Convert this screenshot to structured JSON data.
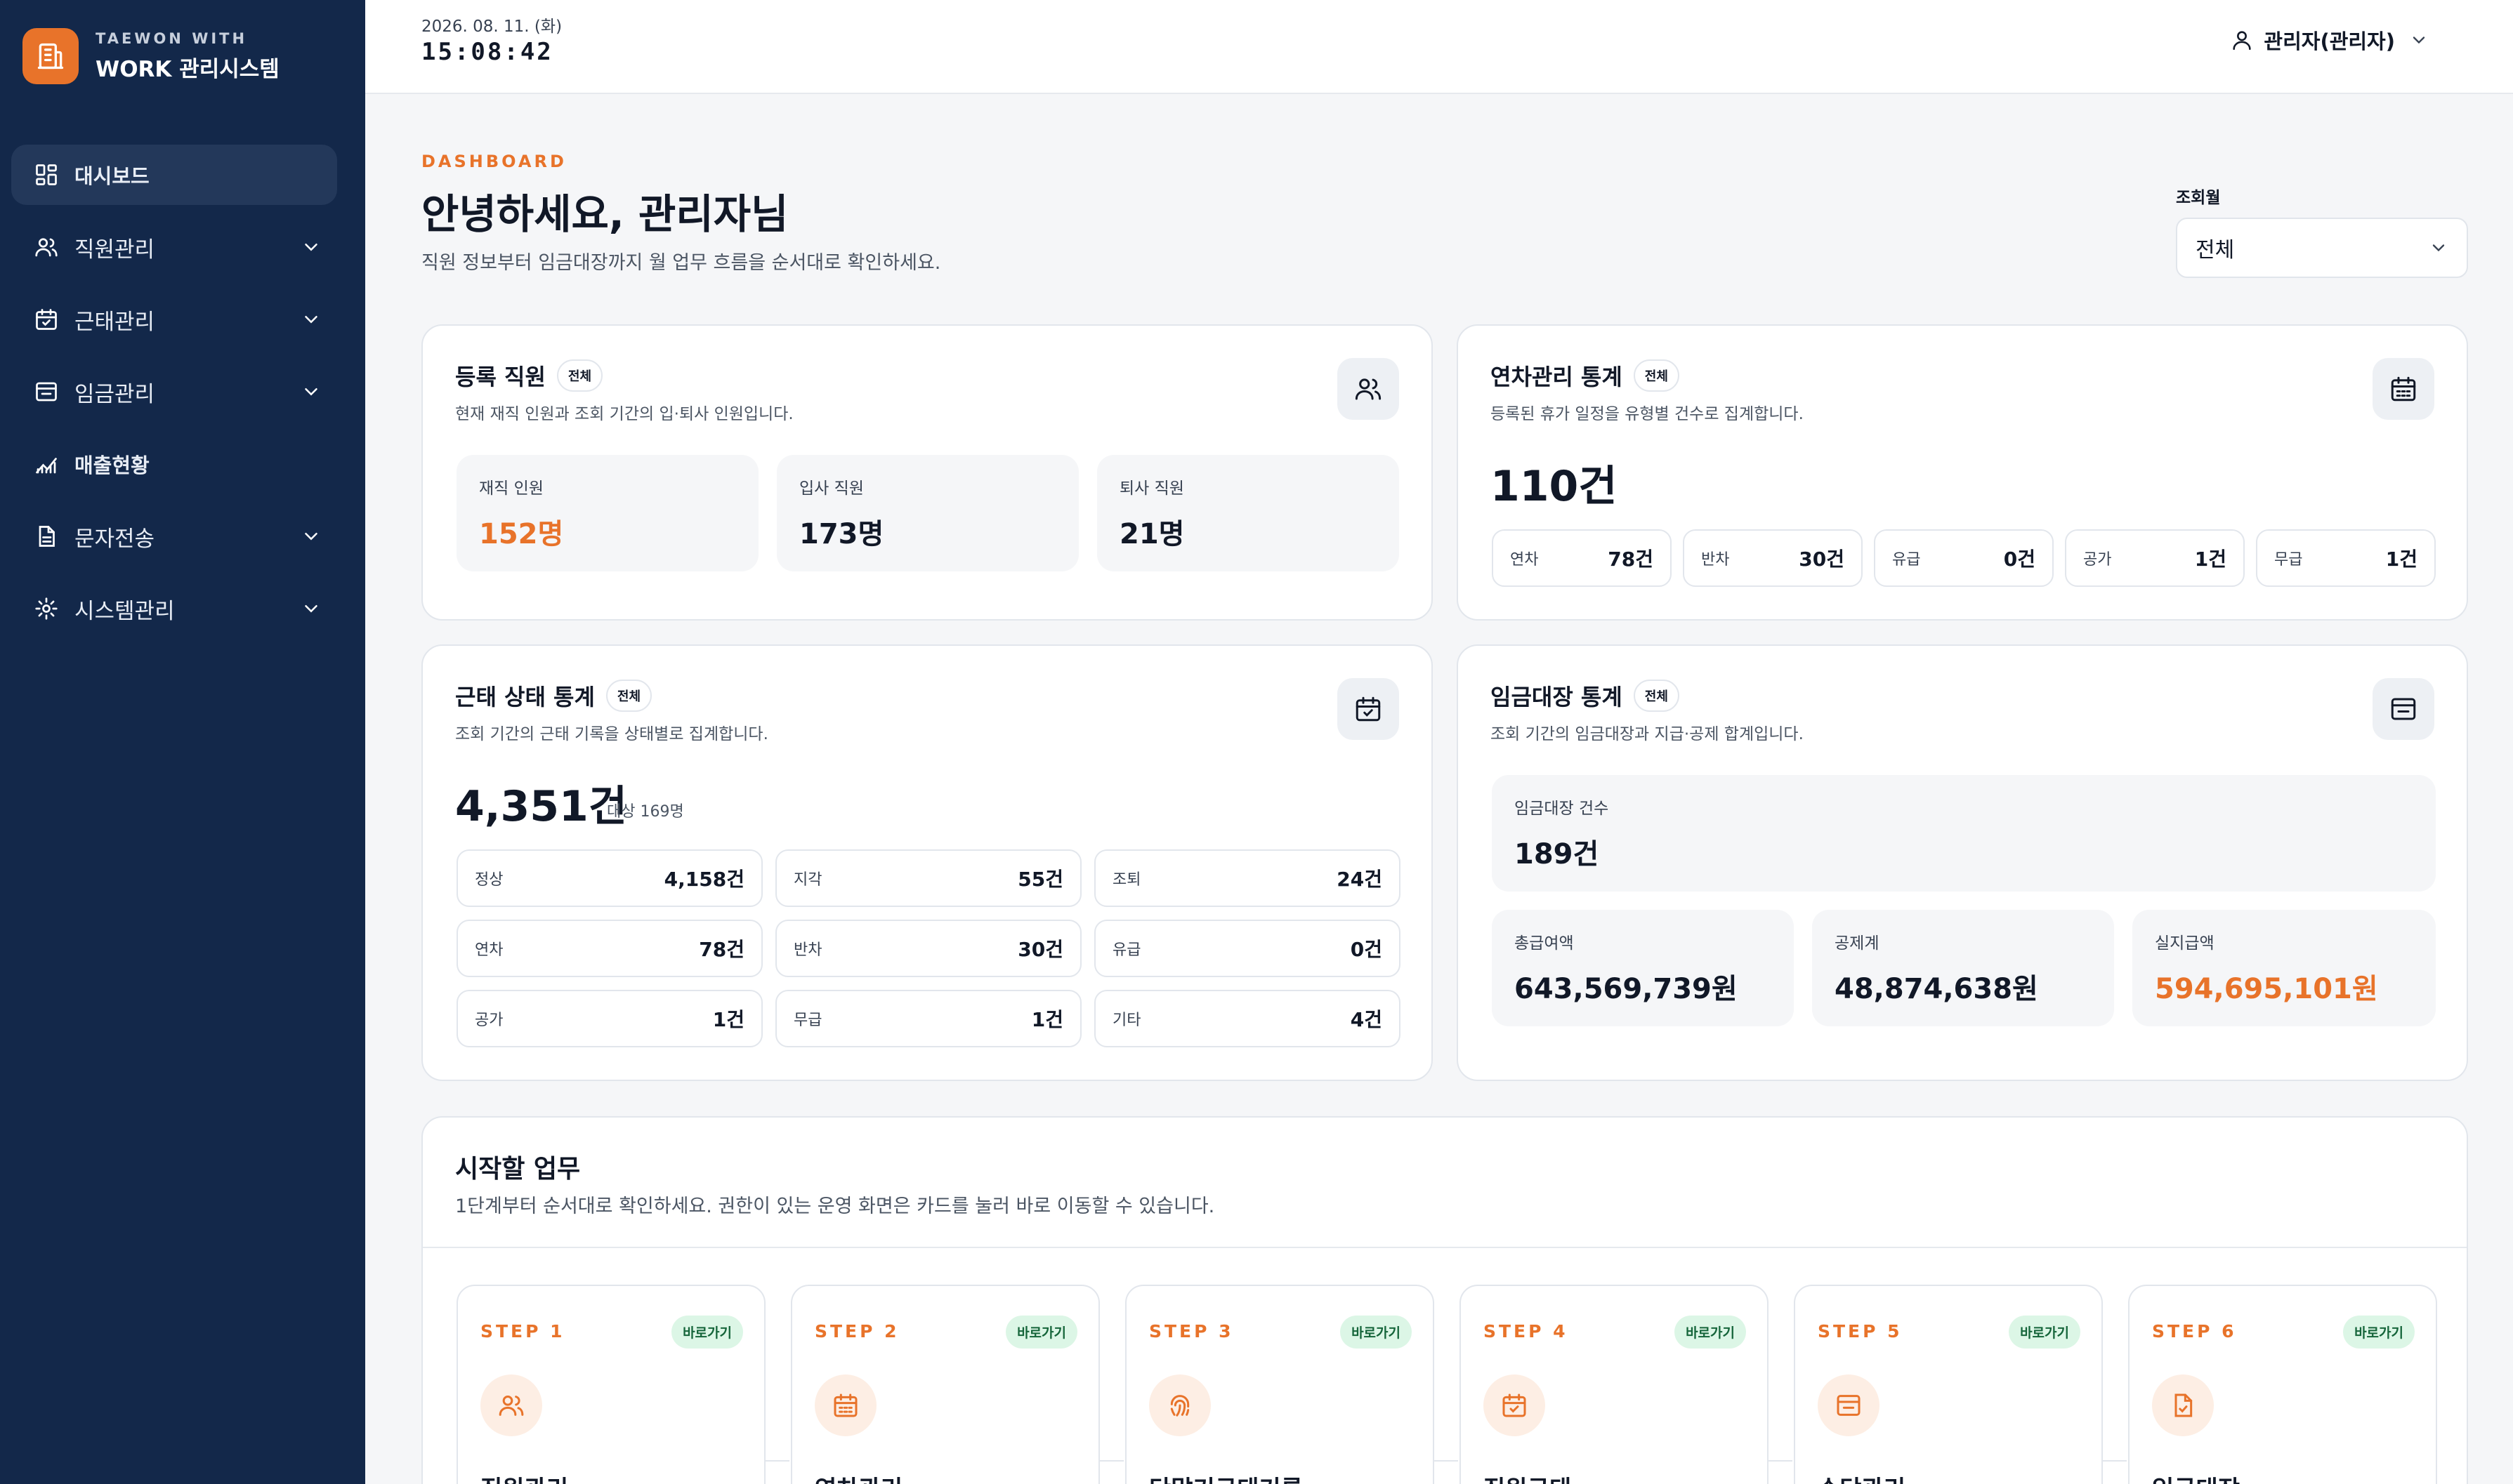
{
  "brand": {
    "sub": "TAEWON WITH",
    "title": "WORK 관리시스템"
  },
  "sidebar": {
    "items": [
      {
        "label": "대시보드",
        "icon": "dashboard-icon"
      },
      {
        "label": "직원관리",
        "icon": "users-icon"
      },
      {
        "label": "근태관리",
        "icon": "calendar-check-icon"
      },
      {
        "label": "임금관리",
        "icon": "wallet-icon"
      },
      {
        "label": "매출현황",
        "icon": "chart-icon"
      },
      {
        "label": "문자전송",
        "icon": "document-icon"
      },
      {
        "label": "시스템관리",
        "icon": "gear-icon"
      }
    ]
  },
  "topbar": {
    "date": "2026. 08. 11. (화)",
    "time": "15:08:42",
    "user": "관리자(관리자)"
  },
  "header": {
    "eyebrow": "DASHBOARD",
    "title": "안녕하세요, 관리자님",
    "desc": "직원 정보부터 임금대장까지 월 업무 흐름을 순서대로 확인하세요.",
    "period_label": "조회월",
    "period_value": "전체"
  },
  "employees": {
    "title": "등록 직원",
    "badge": "전체",
    "desc": "현재 재직 인원과 조회 기간의 입·퇴사 인원입니다.",
    "stats": [
      {
        "label": "재직 인원",
        "value": "152명"
      },
      {
        "label": "입사 직원",
        "value": "173명"
      },
      {
        "label": "퇴사 직원",
        "value": "21명"
      }
    ]
  },
  "leave": {
    "title": "연차관리 통계",
    "badge": "전체",
    "desc": "등록된 휴가 일정을 유형별 건수로 집계합니다.",
    "total": "110건",
    "chips": [
      {
        "label": "연차",
        "value": "78건"
      },
      {
        "label": "반차",
        "value": "30건"
      },
      {
        "label": "유급",
        "value": "0건"
      },
      {
        "label": "공가",
        "value": "1건"
      },
      {
        "label": "무급",
        "value": "1건"
      }
    ]
  },
  "attendance": {
    "title": "근태 상태 통계",
    "badge": "전체",
    "desc": "조회 기간의 근태 기록을 상태별로 집계합니다.",
    "total": "4,351건",
    "sub": "대상 169명",
    "chips": [
      {
        "label": "정상",
        "value": "4,158건"
      },
      {
        "label": "지각",
        "value": "55건"
      },
      {
        "label": "조퇴",
        "value": "24건"
      },
      {
        "label": "연차",
        "value": "78건"
      },
      {
        "label": "반차",
        "value": "30건"
      },
      {
        "label": "유급",
        "value": "0건"
      },
      {
        "label": "공가",
        "value": "1건"
      },
      {
        "label": "무급",
        "value": "1건"
      },
      {
        "label": "기타",
        "value": "4건"
      }
    ]
  },
  "payroll": {
    "title": "임금대장 통계",
    "badge": "전체",
    "desc": "조회 기간의 임금대장과 지급·공제 합계입니다.",
    "count_label": "임금대장 건수",
    "count_value": "189건",
    "stats": [
      {
        "label": "총급여액",
        "value": "643,569,739원"
      },
      {
        "label": "공제계",
        "value": "48,874,638원"
      },
      {
        "label": "실지급액",
        "value": "594,695,101원"
      }
    ]
  },
  "tasks": {
    "title": "시작할 업무",
    "desc": "1단계부터 순서대로 확인하세요. 권한이 있는 운영 화면은 카드를 눌러 바로 이동할 수 있습니다.",
    "badge": "바로가기",
    "steps": [
      {
        "step": "STEP 1",
        "name": "직원관리",
        "icon": "users-icon"
      },
      {
        "step": "STEP 2",
        "name": "연차관리",
        "icon": "calendar-icon"
      },
      {
        "step": "STEP 3",
        "name": "단말기근태기록",
        "icon": "fingerprint-icon"
      },
      {
        "step": "STEP 4",
        "name": "직원근태",
        "icon": "calendar-check-icon"
      },
      {
        "step": "STEP 5",
        "name": "수당관리",
        "icon": "wallet-icon"
      },
      {
        "step": "STEP 6",
        "name": "임금대장",
        "icon": "file-icon"
      }
    ]
  },
  "colors": {
    "sidebar": "#13284a",
    "accent": "#e8732a",
    "badge_green": "#dcf6e6"
  }
}
